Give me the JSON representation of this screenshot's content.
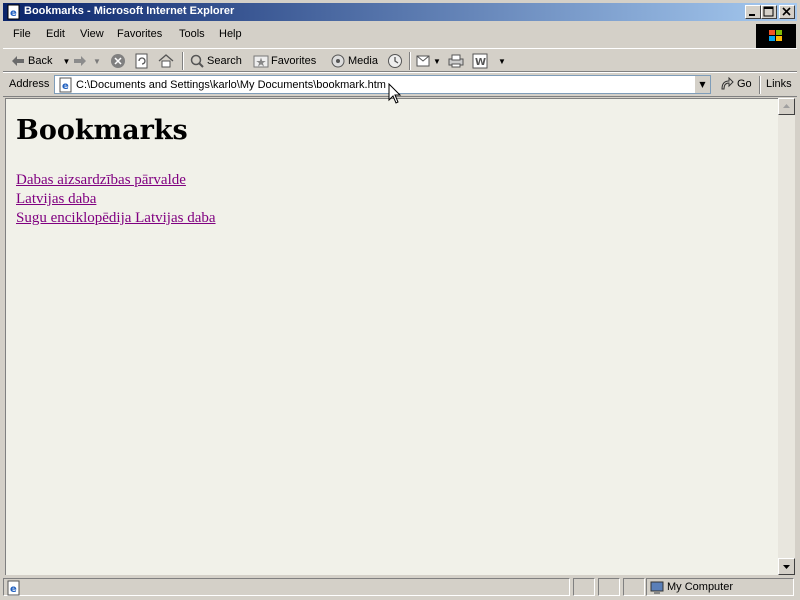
{
  "window": {
    "title": "Bookmarks - Microsoft Internet Explorer"
  },
  "menu": {
    "items": [
      "File",
      "Edit",
      "View",
      "Favorites",
      "Tools",
      "Help"
    ]
  },
  "toolbar": {
    "back_label": "Back",
    "search_label": "Search",
    "favorites_label": "Favorites",
    "media_label": "Media"
  },
  "address": {
    "label": "Address",
    "value": "C:\\Documents and Settings\\karlo\\My Documents\\bookmark.htm",
    "go_label": "Go",
    "links_label": "Links"
  },
  "page": {
    "heading": "Bookmarks",
    "links": [
      "Dabas aizsardzības pārvalde",
      "Latvijas daba",
      "Sugu enciklopēdija Latvijas daba"
    ]
  },
  "status": {
    "zone": "My Computer"
  },
  "colors": {
    "title_start": "#0a246a",
    "title_end": "#a6caf0",
    "link_visited": "#800080",
    "page_bg": "#f1f1e9"
  }
}
